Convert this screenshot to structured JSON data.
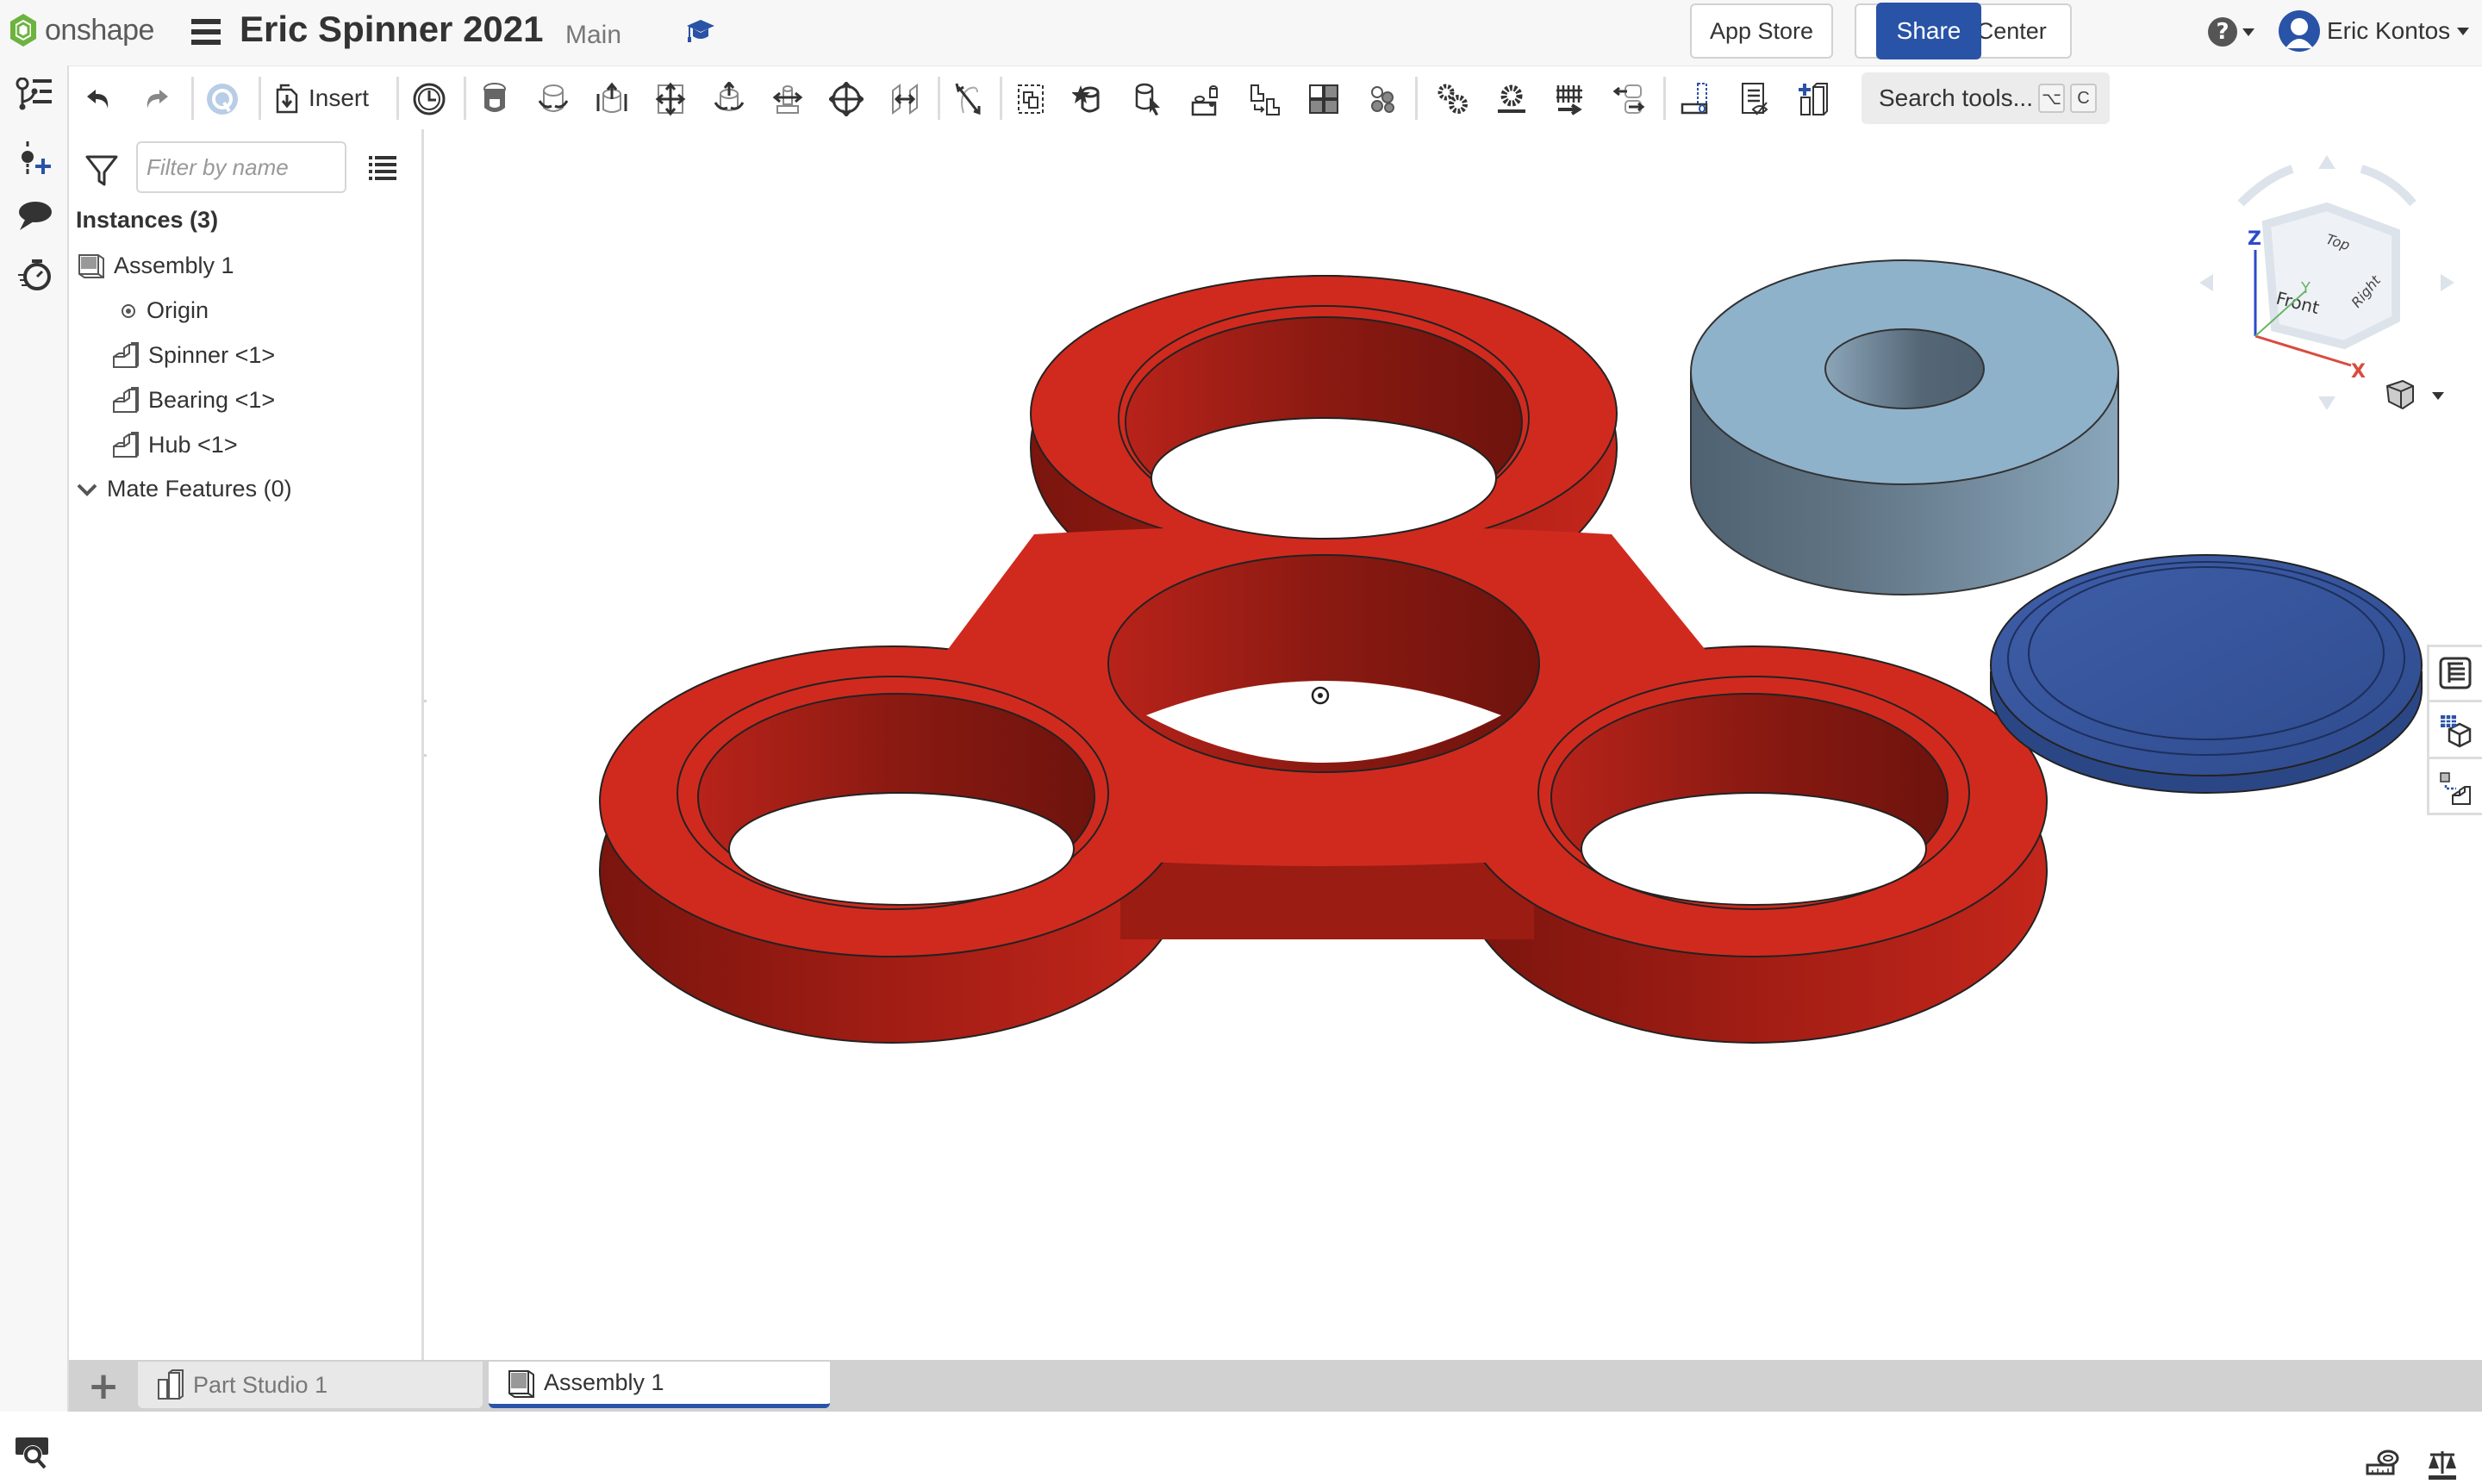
{
  "app": {
    "brand": "onshape",
    "document_title": "Eric Spinner 2021",
    "branch": "Main"
  },
  "header": {
    "app_store_label": "App Store",
    "learning_center_label": "Learning Center",
    "share_label": "Share",
    "help_icon": "?",
    "user_name": "Eric Kontos"
  },
  "toolbar": {
    "insert_label": "Insert",
    "search_tools_label": "Search tools...",
    "search_shortcut_keys": [
      "⌥",
      "C"
    ],
    "tools": [
      "undo-icon",
      "redo-icon",
      "render-studio-icon",
      "insert-icon",
      "named-positions-icon",
      "fastened-mate-icon",
      "revolute-mate-icon",
      "slider-mate-icon",
      "planar-mate-icon",
      "cylindrical-mate-icon",
      "pin-slot-mate-icon",
      "ball-mate-icon",
      "parallel-mate-icon",
      "tangent-mate-icon",
      "group-icon",
      "replicate-icon",
      "mate-connector-icon",
      "linear-pattern-icon",
      "circular-pattern-icon",
      "explode-icon",
      "mate-fit-icon",
      "gear-relation-icon",
      "rack-pinion-relation-icon",
      "screw-relation-icon",
      "linear-relation-icon",
      "section-view-icon",
      "display-states-icon",
      "insert-part-studio-icon"
    ]
  },
  "feature_panel": {
    "filter_placeholder": "Filter by name",
    "instances_heading": "Instances (3)",
    "tree": [
      {
        "label": "Assembly 1",
        "icon": "assembly-icon"
      },
      {
        "label": "Origin",
        "icon": "origin-icon"
      },
      {
        "label": "Spinner <1>",
        "icon": "part-instance-icon"
      },
      {
        "label": "Bearing <1>",
        "icon": "part-instance-icon"
      },
      {
        "label": "Hub <1>",
        "icon": "part-instance-icon"
      }
    ],
    "mate_features_label": "Mate Features (0)"
  },
  "view_cube": {
    "faces": [
      "Top",
      "Front",
      "Right"
    ],
    "axes": [
      "X",
      "Y",
      "Z"
    ]
  },
  "model": {
    "parts": [
      {
        "name": "Spinner",
        "color": "#d02a1f"
      },
      {
        "name": "Bearing",
        "color": "#8fb2cb"
      },
      {
        "name": "Hub",
        "color": "#3a56a0"
      }
    ]
  },
  "tabs": [
    {
      "label": "Part Studio 1",
      "active": false
    },
    {
      "label": "Assembly 1",
      "active": true
    }
  ],
  "colors": {
    "accent": "#2953a6",
    "topbar_bg": "#f7f7f7",
    "tabbar_bg": "#d1d1d1"
  }
}
